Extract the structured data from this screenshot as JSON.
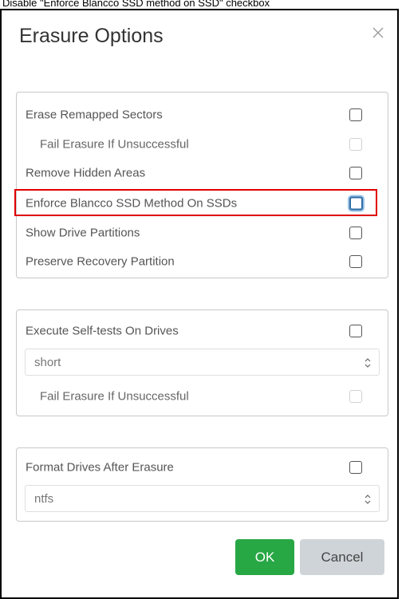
{
  "caption": "Disable \"Enforce Blancco SSD method on SSD\" checkbox",
  "dialog": {
    "title": "Erasure Options",
    "close_icon": "close-icon"
  },
  "panel1": {
    "rows": [
      {
        "label": "Erase Remapped Sectors",
        "checked": false,
        "disabled": false
      },
      {
        "label": "Fail Erasure If Unsuccessful",
        "checked": false,
        "disabled": true
      },
      {
        "label": "Remove Hidden Areas",
        "checked": false,
        "disabled": false
      },
      {
        "label": "Enforce Blancco SSD Method On SSDs",
        "checked": false,
        "disabled": false,
        "highlighted": true
      },
      {
        "label": "Show Drive Partitions",
        "checked": false,
        "disabled": false
      },
      {
        "label": "Preserve Recovery Partition",
        "checked": false,
        "disabled": false
      }
    ]
  },
  "panel2": {
    "self_test_label": "Execute Self-tests On Drives",
    "self_test_select": "short",
    "fail_label": "Fail Erasure If Unsuccessful"
  },
  "panel3": {
    "format_label": "Format Drives After Erasure",
    "format_select": "ntfs"
  },
  "buttons": {
    "ok": "OK",
    "cancel": "Cancel"
  },
  "colors": {
    "highlight": "#e00000",
    "ok_button": "#28a745",
    "cancel_button": "#cfd4d8",
    "focus_ring": "#2f6ea5"
  }
}
